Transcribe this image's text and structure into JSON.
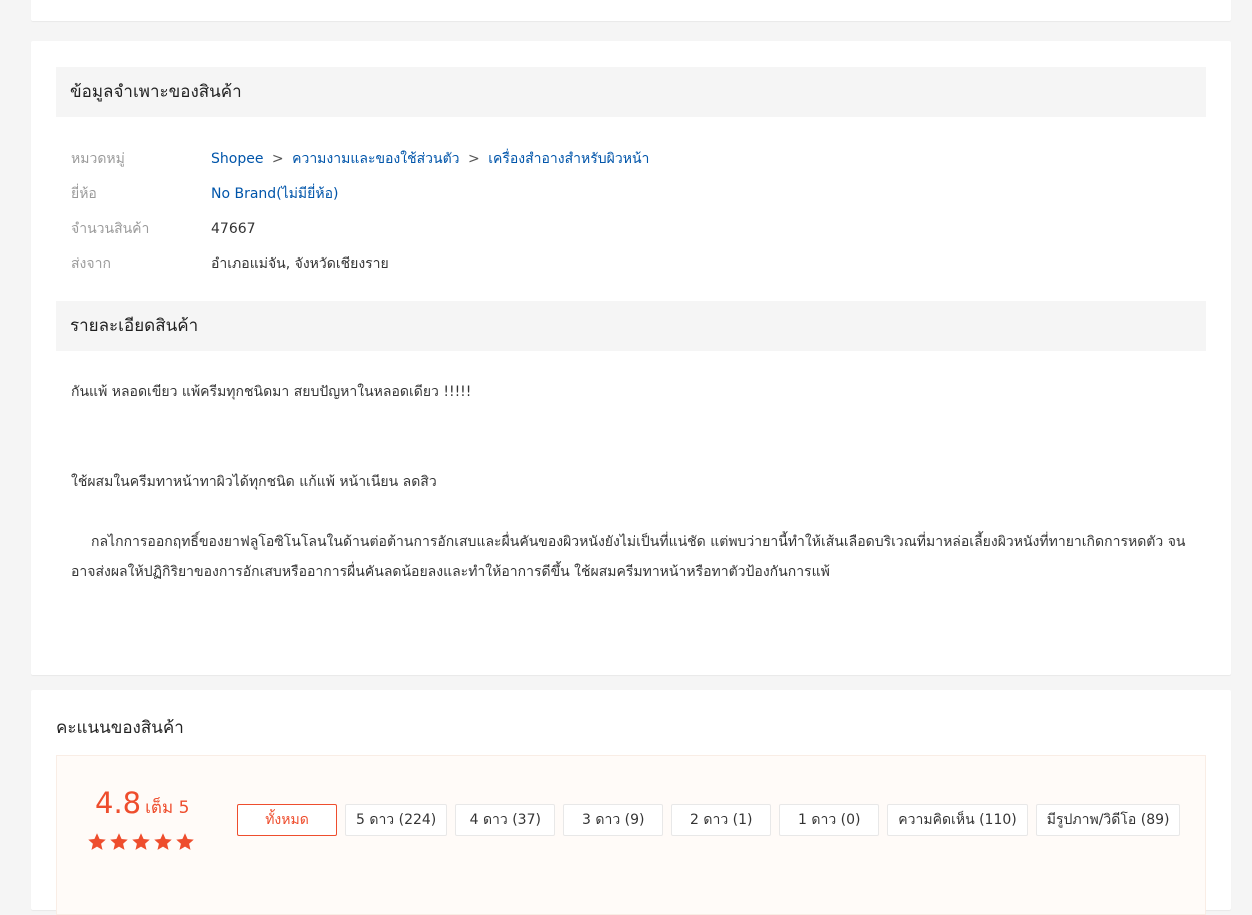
{
  "specs": {
    "title": "ข้อมูลจำเพาะของสินค้า",
    "rows": [
      {
        "label": "หมวดหมู่"
      },
      {
        "label": "ยี่ห้อ",
        "value": "No Brand(ไม่มียี่ห้อ)"
      },
      {
        "label": "จำนวนสินค้า",
        "value": "47667"
      },
      {
        "label": "ส่งจาก",
        "value": "อำเภอแม่จัน, จังหวัดเชียงราย"
      }
    ],
    "breadcrumb": [
      "Shopee",
      "ความงามและของใช้ส่วนตัว",
      "เครื่องสำอางสำหรับผิวหน้า"
    ],
    "separator": ">"
  },
  "description": {
    "title": "รายละเอียดสินค้า",
    "paragraphs": [
      "กันแพ้ หลอดเขียว  แพ้ครีมทุกชนิดมา สยบปัญหาในหลอดเดียว !!!!!",
      "ใช้ผสมในครีมทาหน้าทาผิวได้ทุกชนิด แก้แพ้ หน้าเนียน ลดสิว",
      "กลไกการออกฤทธิ์ของยาฟลูโอซิโนโลนในด้านต่อต้านการอักเสบและผื่นคันของผิวหนังยังไม่เป็นที่แน่ชัด แต่พบว่ายานี้ทำให้เส้นเลือดบริเวณที่มาหล่อเลี้ยงผิวหนังที่ทายาเกิดการหดตัว จนอาจส่งผลให้ปฏิกิริยาของการอักเสบหรืออาการผื่นคันลดน้อยลงและทำให้อาการดีขึ้น ใช้ผสมครีมทาหน้าหรือทาตัวป้องกันการแพ้"
    ]
  },
  "rating": {
    "title": "คะแนนของสินค้า",
    "score": "4.8",
    "out_of": "เต็ม 5",
    "stars": 5,
    "filters": [
      "ทั้งหมด",
      "5 ดาว (224)",
      "4 ดาว (37)",
      "3 ดาว (9)",
      "2 ดาว (1)",
      "1 ดาว (0)",
      "ความคิดเห็น (110)",
      "มีรูปภาพ/วิดีโอ (89)"
    ]
  },
  "colors": {
    "accent": "#ee4d2d",
    "link": "#0055aa"
  }
}
